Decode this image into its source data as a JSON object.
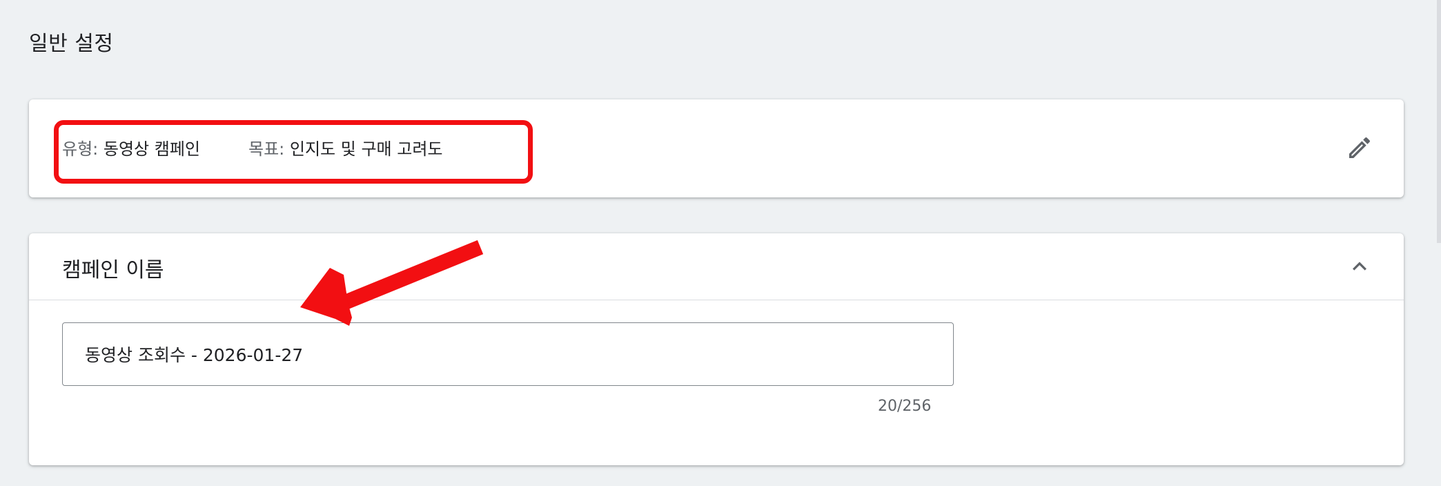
{
  "page": {
    "section_title": "일반 설정"
  },
  "summary": {
    "type_label": "유형:",
    "type_value": "동영상 캠페인",
    "goal_label": "목표:",
    "goal_value": "인지도 및 구매 고려도",
    "edit_icon": "pencil-icon"
  },
  "campaign_name": {
    "title": "캠페인 이름",
    "collapse_icon": "chevron-up-icon",
    "input_value": "동영상 조회수 - 2026-01-27",
    "char_count": "20/256"
  },
  "annotations": {
    "highlight_color": "#f20f12",
    "arrow_color": "#f20f12"
  },
  "colors": {
    "background": "#eef1f3",
    "card": "#ffffff",
    "text_primary": "#202124",
    "text_secondary": "#5f6368"
  }
}
